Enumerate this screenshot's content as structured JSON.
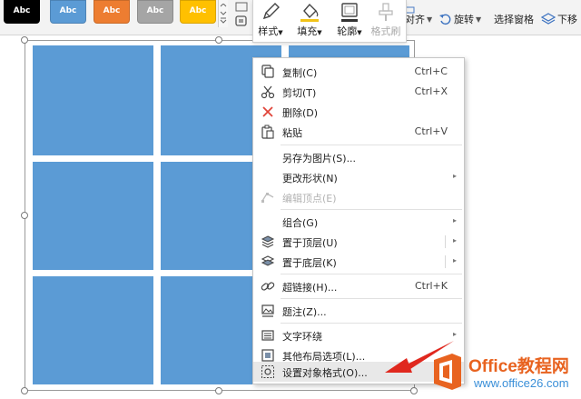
{
  "ribbon": {
    "style_swatches": [
      {
        "label": "Abc",
        "color": "#000000"
      },
      {
        "label": "Abc",
        "color": "#5b9bd5"
      },
      {
        "label": "Abc",
        "color": "#ed7d31"
      },
      {
        "label": "Abc",
        "color": "#a5a5a5"
      },
      {
        "label": "Abc",
        "color": "#ffc000"
      }
    ],
    "tools": {
      "style": {
        "label": "样式",
        "has_dropdown": true
      },
      "fill": {
        "label": "填充",
        "has_dropdown": true
      },
      "outline": {
        "label": "轮廓",
        "has_dropdown": true
      },
      "format_painter": {
        "label": "格式刷",
        "disabled": true
      }
    },
    "align": {
      "label": "对齐"
    },
    "rotate": {
      "label": "旋转"
    },
    "selection_pane": {
      "label": "选择窗格"
    },
    "move_down": {
      "label": "下移"
    }
  },
  "context_menu": {
    "items": [
      {
        "label": "复制(C)",
        "shortcut": "Ctrl+C",
        "icon": "copy-icon"
      },
      {
        "label": "剪切(T)",
        "shortcut": "Ctrl+X",
        "icon": "cut-icon"
      },
      {
        "label": "删除(D)",
        "icon": "delete-icon"
      },
      {
        "label": "粘贴",
        "shortcut": "Ctrl+V",
        "icon": "paste-icon"
      },
      {
        "label": "另存为图片(S)..."
      },
      {
        "label": "更改形状(N)",
        "submenu": true
      },
      {
        "label": "编辑顶点(E)",
        "disabled": true,
        "icon": "edit-points-icon"
      },
      {
        "label": "组合(G)",
        "submenu": true
      },
      {
        "label": "置于顶层(U)",
        "submenu": true,
        "icon": "bring-to-front-icon"
      },
      {
        "label": "置于底层(K)",
        "submenu": true,
        "icon": "send-to-back-icon"
      },
      {
        "label": "超链接(H)...",
        "shortcut": "Ctrl+K",
        "icon": "hyperlink-icon"
      },
      {
        "label": "题注(Z)...",
        "icon": "caption-icon"
      },
      {
        "label": "文字环绕",
        "submenu": true,
        "icon": "text-wrap-icon"
      },
      {
        "label": "其他布局选项(L)...",
        "icon": "layout-options-icon"
      },
      {
        "label": "设置对象格式(O)...",
        "icon": "format-object-icon",
        "highlighted": true
      }
    ]
  },
  "colors": {
    "shape_fill": "#5b9bd5",
    "delete_red": "#e0453a",
    "annotation_red": "#e0281e",
    "watermark_orange": "#e86320",
    "watermark_blue": "#3a8fd8"
  },
  "watermark": {
    "title": "Office教程网",
    "url": "www.office26.com"
  }
}
